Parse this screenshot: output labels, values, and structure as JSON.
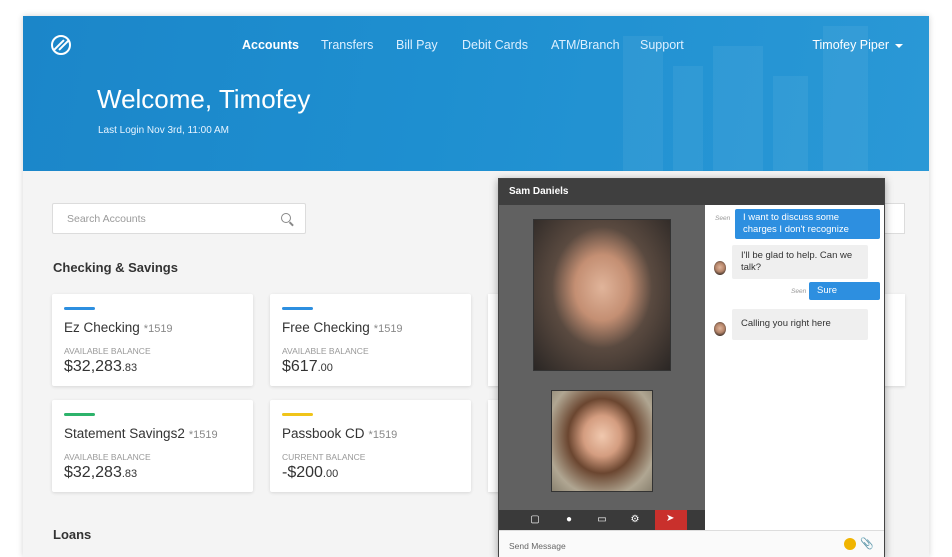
{
  "nav": {
    "items": [
      {
        "label": "Accounts",
        "active": true
      },
      {
        "label": "Transfers",
        "active": false
      },
      {
        "label": "Bill Pay",
        "active": false
      },
      {
        "label": "Debit Cards",
        "active": false
      },
      {
        "label": "ATM/Branch",
        "active": false
      },
      {
        "label": "Support",
        "active": false
      }
    ],
    "user": "Timofey Piper"
  },
  "hero": {
    "welcome": "Welcome, Timofey",
    "last_login": "Last Login Nov 3rd, 11:00 AM"
  },
  "search": {
    "placeholder": "Search Accounts"
  },
  "sections": {
    "checking": "Checking & Savings",
    "loans": "Loans"
  },
  "accounts": [
    {
      "name": "Ez Checking",
      "number": "*1519",
      "balance_label": "AVAILABLE BALANCE",
      "dollars": "$32,283",
      "cents": ".83",
      "color": "#2d8fe0"
    },
    {
      "name": "Free Checking",
      "number": "*1519",
      "balance_label": "AVAILABLE BALANCE",
      "dollars": "$617",
      "cents": ".00",
      "color": "#2d8fe0"
    },
    {
      "name": "Statement Savings2",
      "number": "*1519",
      "balance_label": "AVAILABLE BALANCE",
      "dollars": "$32,283",
      "cents": ".83",
      "color": "#2db36b"
    },
    {
      "name": "Passbook CD",
      "number": "*1519",
      "balance_label": "CURRENT BALANCE",
      "dollars": "-$200",
      "cents": ".00",
      "color": "#f0c419"
    }
  ],
  "chat": {
    "contact": "Sam Daniels",
    "messages": [
      {
        "from": "me",
        "seen": "Seen",
        "text": "I want to discuss some charges I don't recognize"
      },
      {
        "from": "agent",
        "text": "I'll be glad to help. Can we talk?"
      },
      {
        "from": "me",
        "seen": "Seen",
        "text": "Sure"
      },
      {
        "from": "agent",
        "text": "Calling you right here"
      }
    ],
    "input_placeholder": "Send Message"
  }
}
